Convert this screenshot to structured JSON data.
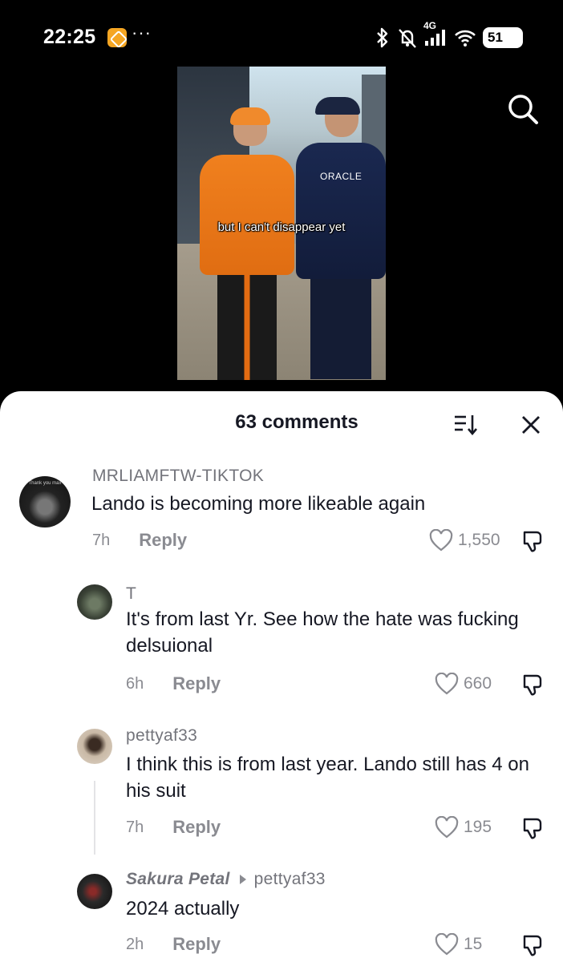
{
  "status_bar": {
    "time": "22:25",
    "dots": "···",
    "network": "4G",
    "battery": "51"
  },
  "video": {
    "caption": "but I can't disappear yet",
    "sponsor_text": "ORACLE"
  },
  "comments_panel": {
    "title": "63 comments",
    "comments": [
      {
        "username": "MRLIAMFTW-TIKTOK",
        "avatar_text": "Thank you max",
        "text": "Lando is becoming more likeable again",
        "time": "7h",
        "reply_label": "Reply",
        "likes": "1,550"
      },
      {
        "username": "T",
        "text": "It's from last Yr. See how the hate was fucking delsuional",
        "time": "6h",
        "reply_label": "Reply",
        "likes": "660"
      },
      {
        "username": "pettyaf33",
        "text": "I think this is from last year. Lando still has 4 on his suit",
        "time": "7h",
        "reply_label": "Reply",
        "likes": "195"
      },
      {
        "username": "Sakura Petal",
        "reply_to": "pettyaf33",
        "text": "2024 actually",
        "time": "2h",
        "reply_label": "Reply",
        "likes": "15"
      }
    ]
  },
  "colors": {
    "text_primary": "#161823",
    "text_secondary": "#8a8b91",
    "sheet_bg": "#ffffff",
    "screen_bg": "#000000"
  },
  "icons": [
    "bluetooth-icon",
    "mute-icon",
    "signal-icon",
    "wifi-icon",
    "battery-icon",
    "search-icon",
    "sort-icon",
    "close-icon",
    "heart-icon",
    "dislike-icon"
  ]
}
